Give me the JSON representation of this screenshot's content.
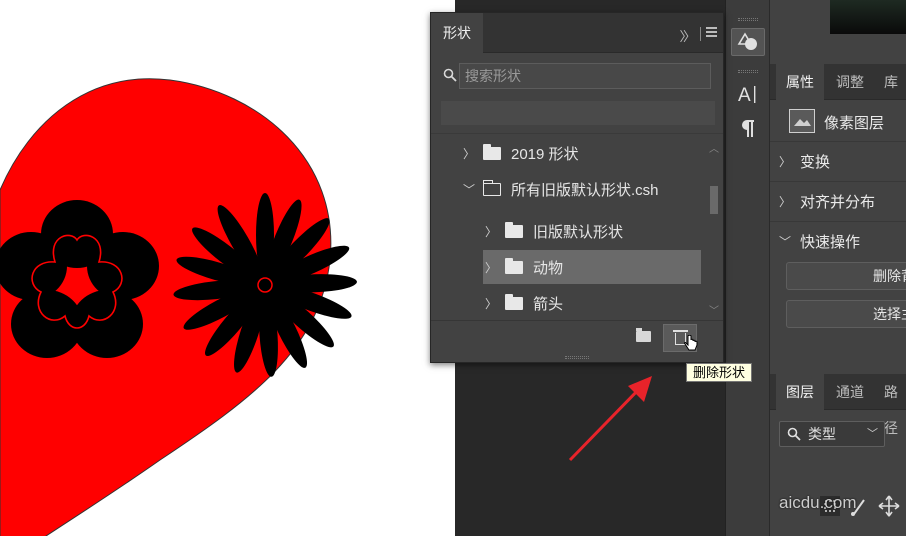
{
  "shapes_panel": {
    "tab_title": "形状",
    "search_placeholder": "搜索形状",
    "tree": [
      {
        "label": "2019 形状",
        "level": 0,
        "expanded": false,
        "selected": false
      },
      {
        "label": "所有旧版默认形状.csh",
        "level": 0,
        "expanded": true,
        "selected": false
      },
      {
        "label": "旧版默认形状",
        "level": 1,
        "expanded": false,
        "selected": false
      },
      {
        "label": "动物",
        "level": 1,
        "expanded": false,
        "selected": true
      },
      {
        "label": "箭头",
        "level": 1,
        "expanded": false,
        "selected": false
      }
    ],
    "footer": {
      "new_group_icon": "folder-icon",
      "delete_icon": "trash-icon"
    }
  },
  "tooltip": {
    "text": "删除形状"
  },
  "right_panel": {
    "tabs": [
      {
        "label": "属性",
        "active": true
      },
      {
        "label": "调整",
        "active": false
      },
      {
        "label": "库",
        "active": false
      }
    ],
    "layer_type": "像素图层",
    "sections": [
      {
        "label": "变换"
      },
      {
        "label": "对齐并分布"
      },
      {
        "label": "快速操作"
      }
    ],
    "quick_actions": [
      "删除背",
      "选择主"
    ],
    "layer_tabs": [
      {
        "label": "图层",
        "active": true
      },
      {
        "label": "通道",
        "active": false
      },
      {
        "label": "路径",
        "active": false
      }
    ],
    "filter_label": "类型"
  },
  "tool_strip": {
    "icons": [
      "shape-tool-icon",
      "type-tool-icon",
      "paragraph-icon"
    ]
  },
  "watermark": "aicdu.com",
  "colors": {
    "heart": "#ff0000",
    "flower": "#000000",
    "panel_bg": "#424242",
    "selected_row": "#6a6a6a",
    "tooltip_bg": "#ffffe1",
    "arrow": "#e8232a"
  }
}
